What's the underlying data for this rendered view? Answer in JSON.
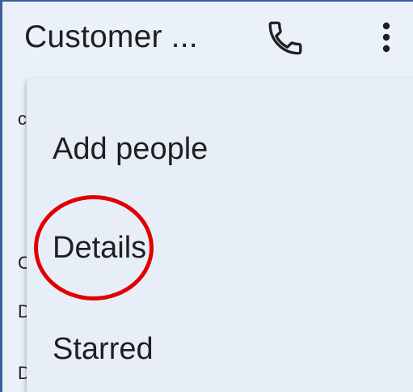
{
  "app_bar": {
    "title": "Customer ...",
    "call_icon": "phone-icon",
    "more_icon": "more-vertical-icon"
  },
  "background_fragments": [
    "c",
    "C",
    "D",
    "D"
  ],
  "menu": {
    "items": [
      {
        "label": "Add people"
      },
      {
        "label": "Details"
      },
      {
        "label": "Starred"
      }
    ]
  },
  "annotation": {
    "color": "#e00000",
    "target": "Details"
  },
  "colors": {
    "surface": "#eaf1fb",
    "menu_surface": "#e8eef8",
    "text": "#1f1f1f",
    "frame": "#3a5f9e"
  }
}
